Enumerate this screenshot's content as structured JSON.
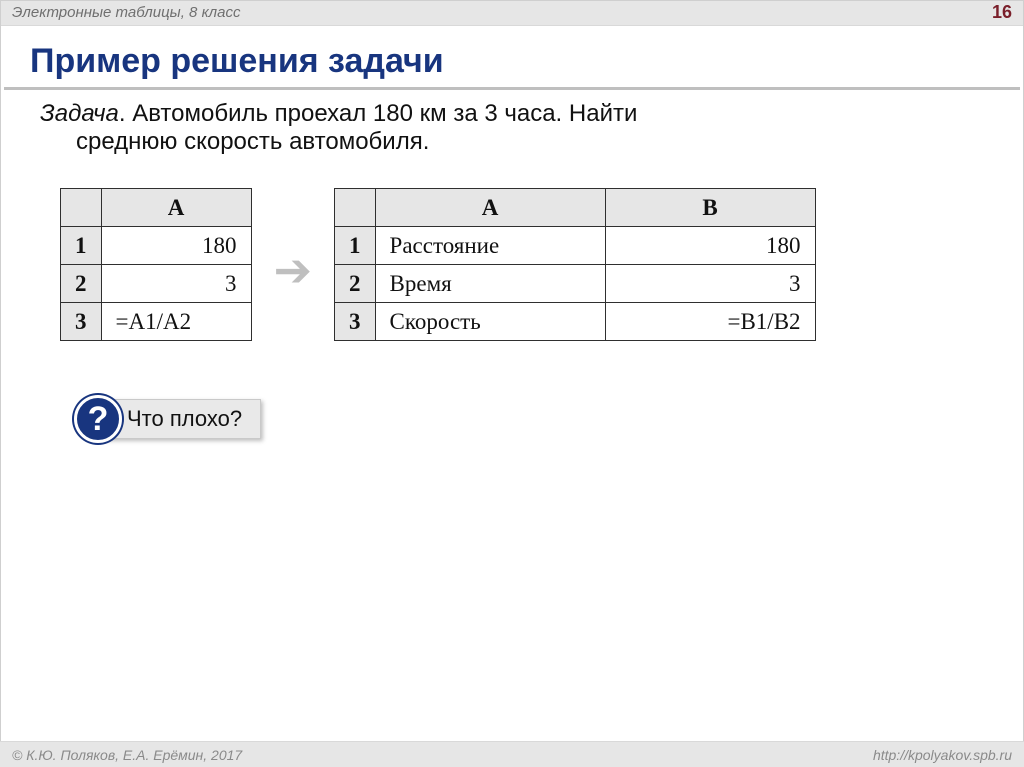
{
  "topbar": {
    "course": "Электронные таблицы, 8 класс",
    "page": "16"
  },
  "title": "Пример решения задачи",
  "problem": {
    "label": "Задача",
    "line1": ". Автомобиль проехал 180 км за 3 часа. Найти",
    "line2": "среднюю скорость автомобиля."
  },
  "table1": {
    "col_headers": {
      "corner": "",
      "A": "A"
    },
    "rows": [
      {
        "n": "1",
        "A": "180"
      },
      {
        "n": "2",
        "A": "3"
      },
      {
        "n": "3",
        "A": "=A1/A2"
      }
    ]
  },
  "arrow_glyph": "➔",
  "table2": {
    "col_headers": {
      "corner": "",
      "A": "A",
      "B": "B"
    },
    "rows": [
      {
        "n": "1",
        "A": "Расстояние",
        "B": "180"
      },
      {
        "n": "2",
        "A": "Время",
        "B": "3"
      },
      {
        "n": "3",
        "A": "Скорость",
        "B": "=B1/B2"
      }
    ]
  },
  "callout": {
    "mark": "?",
    "text": "Что плохо?"
  },
  "footer": {
    "left": "© К.Ю. Поляков, Е.А. Ерёмин, 2017",
    "right": "http://kpolyakov.spb.ru"
  }
}
